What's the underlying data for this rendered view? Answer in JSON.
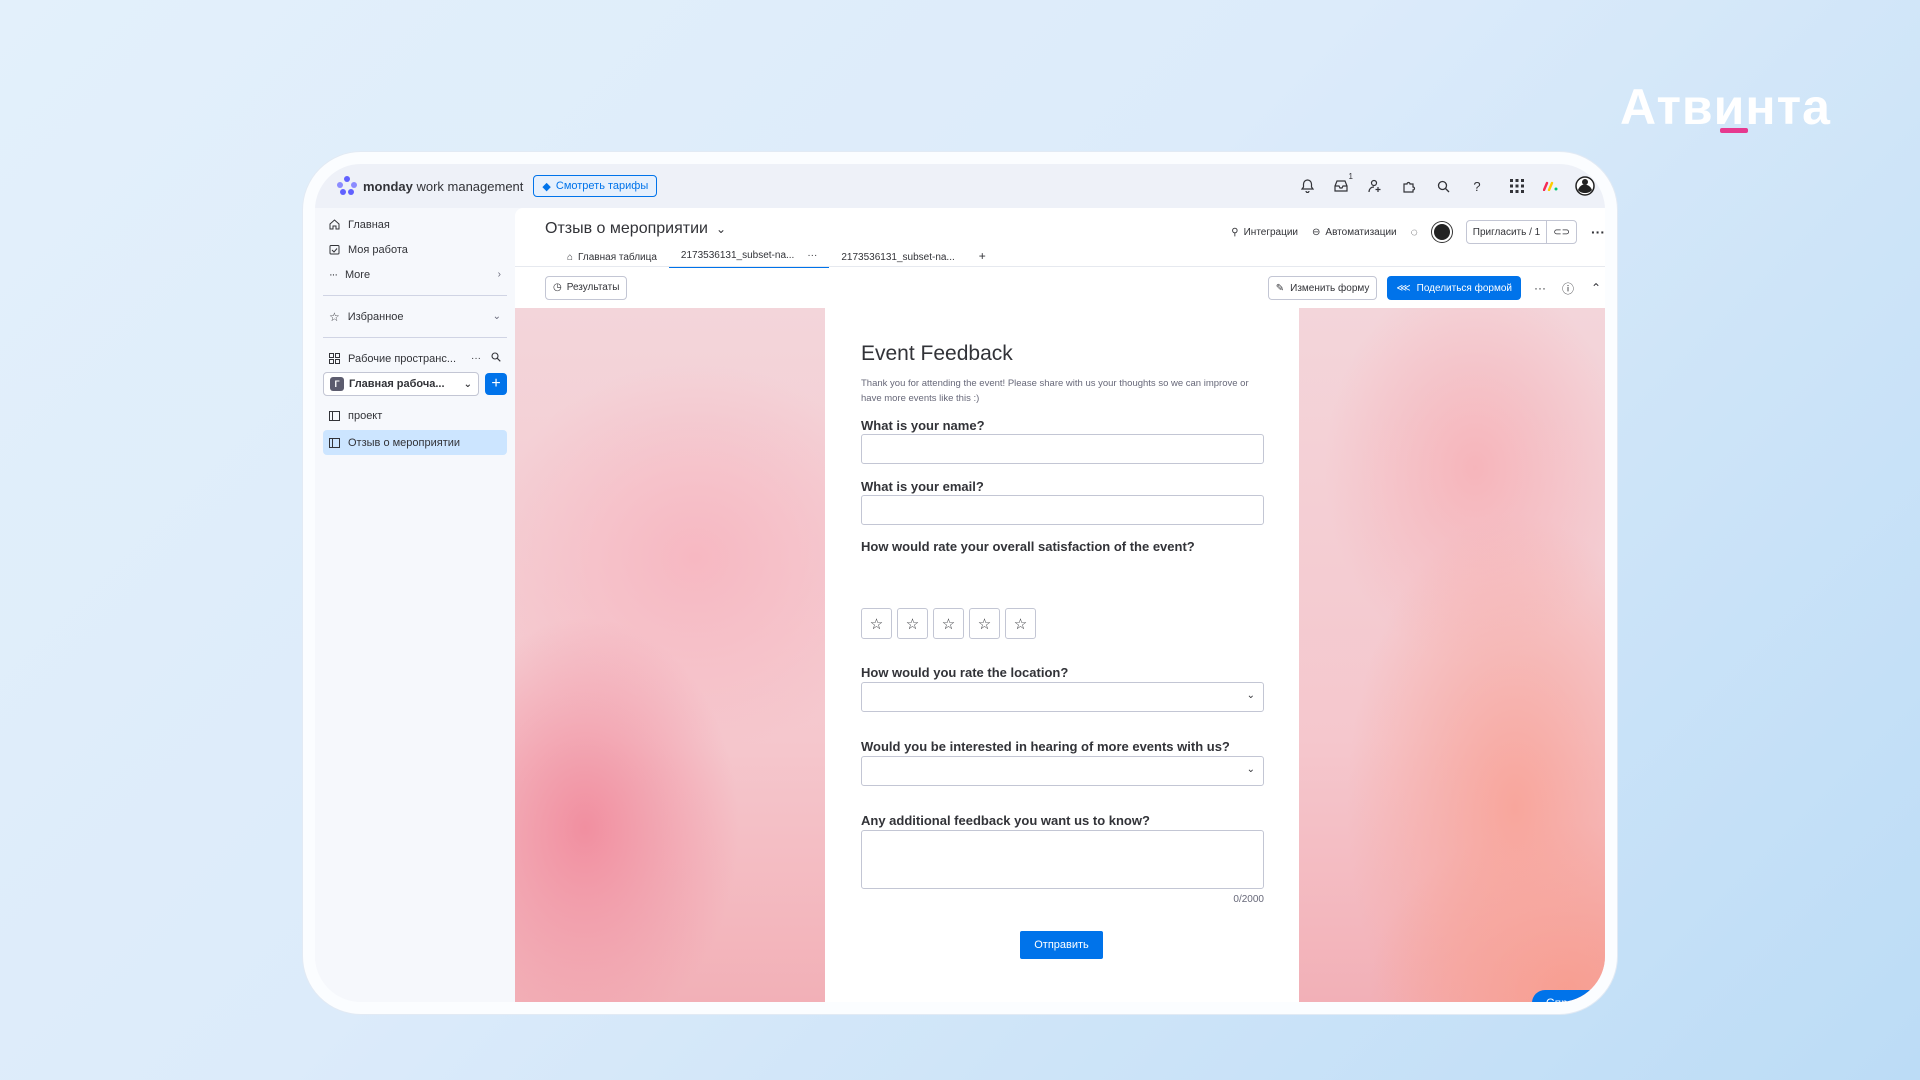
{
  "brand": "Атвинта",
  "topbar": {
    "logo_bold": "monday",
    "logo_light": " work management",
    "tariff_button": "Смотреть тарифы",
    "notifications_badge": "1"
  },
  "sidebar": {
    "items": [
      {
        "label": "Главная",
        "icon": "home-icon"
      },
      {
        "label": "Моя работа",
        "icon": "calendar-check-icon"
      },
      {
        "label": "More",
        "icon": "more-dots-icon"
      }
    ],
    "favorites": "Избранное",
    "workspaces": "Рабочие пространс...",
    "workspace_selected": "Главная рабоча...",
    "workspace_avatar": "Г",
    "boards": [
      {
        "label": "проект"
      },
      {
        "label": "Отзыв о мероприятии"
      }
    ]
  },
  "board": {
    "title": "Отзыв о мероприятии",
    "integrations": "Интеграции",
    "automations": "Автоматизации",
    "invite": "Пригласить / 1",
    "tabs": [
      {
        "label": "Главная таблица"
      },
      {
        "label": "2173536131_subset-na..."
      },
      {
        "label": "2173536131_subset-na..."
      }
    ],
    "tab_add": "+"
  },
  "toolbar": {
    "results": "Результаты",
    "edit_form": "Изменить форму",
    "share_form": "Поделиться формой"
  },
  "form": {
    "title": "Event Feedback",
    "description": "Thank you for attending the event! Please share with us your thoughts so we can improve or have more events like this :)",
    "questions": [
      {
        "label": "What is your name?",
        "type": "text",
        "value": ""
      },
      {
        "label": "What is your email?",
        "type": "text",
        "value": ""
      },
      {
        "label": "How would rate your overall satisfaction of the event?",
        "type": "rating",
        "max": 5,
        "value": 0
      },
      {
        "label": "How would you rate the location?",
        "type": "dropdown",
        "value": ""
      },
      {
        "label": "Would you be interested in hearing of more events with us?",
        "type": "dropdown",
        "value": ""
      },
      {
        "label": "Any additional feedback you want us to know?",
        "type": "textarea",
        "value": ""
      }
    ],
    "counter": "0/2000",
    "submit": "Отправить"
  },
  "help_button": "Справка",
  "colors": {
    "primary": "#0073ea",
    "brand_accent": "#e6398f",
    "active_item": "#cce5ff"
  }
}
